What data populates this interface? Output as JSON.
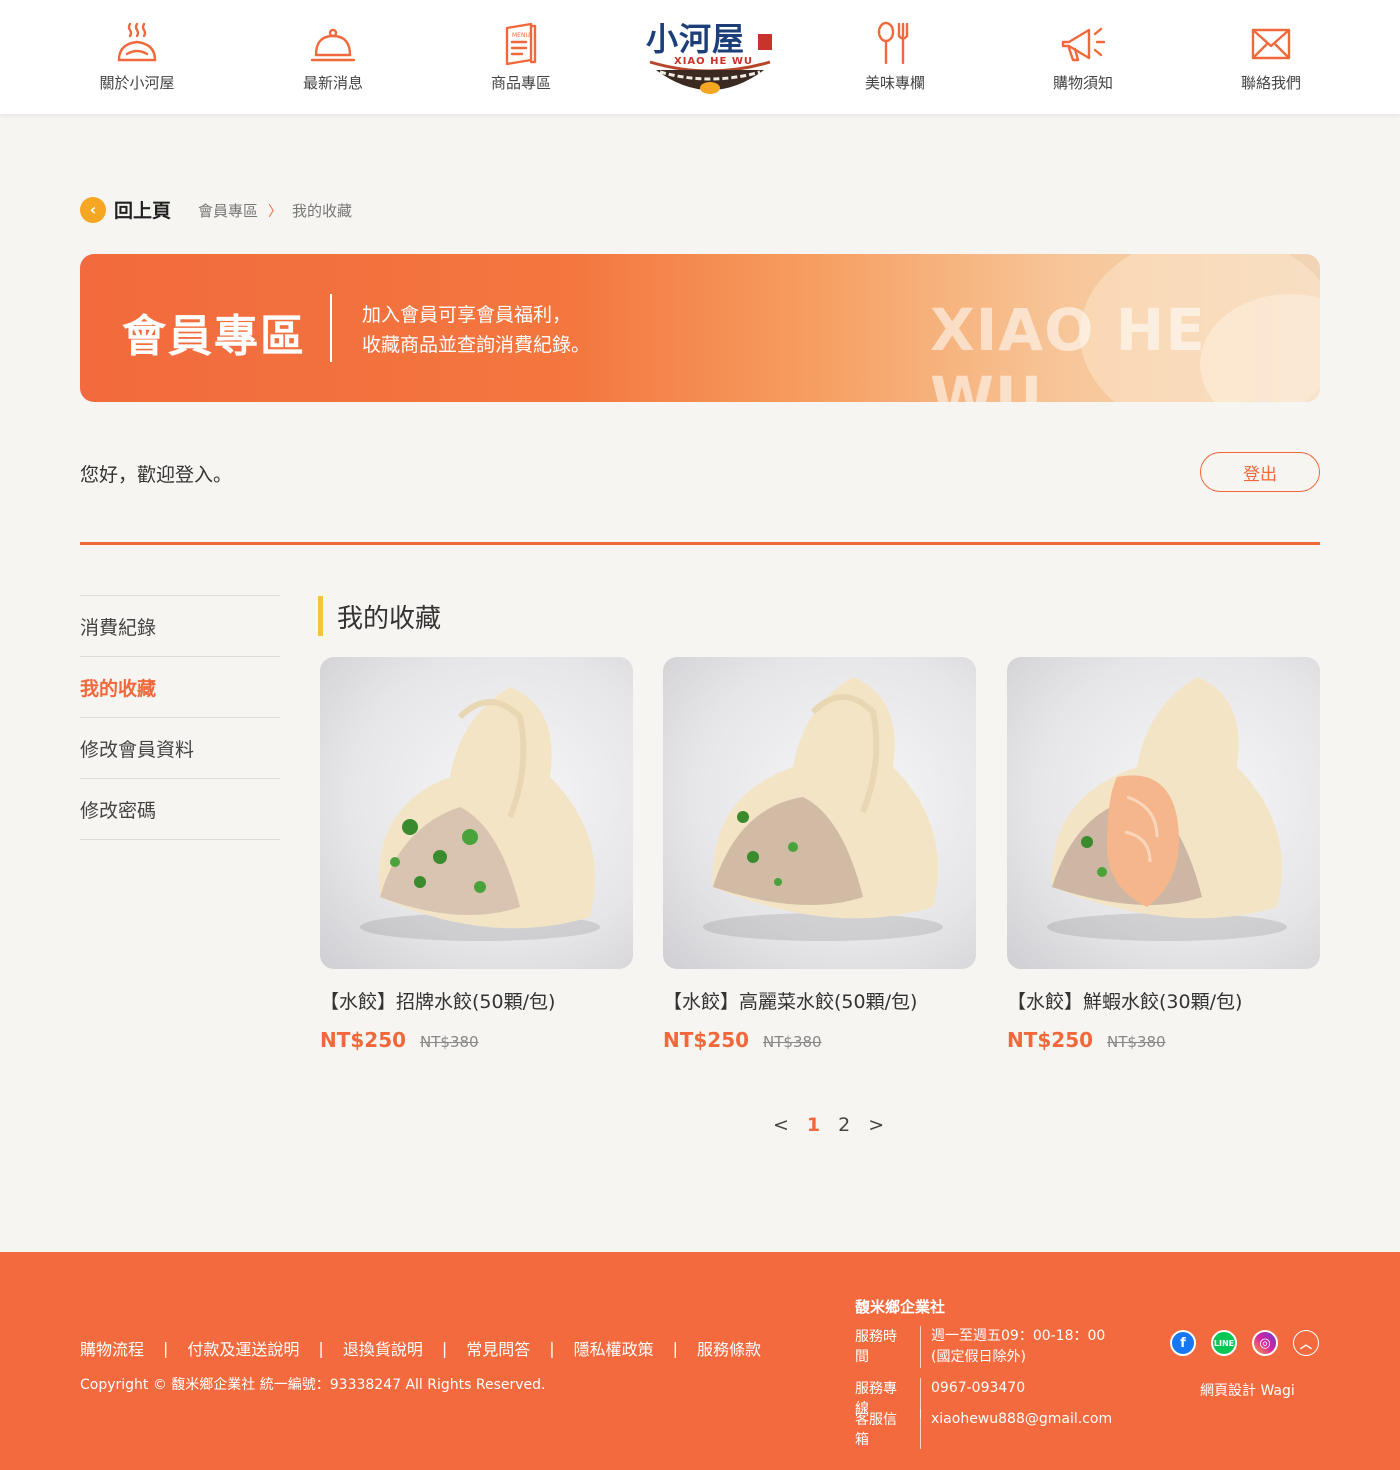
{
  "header": {
    "nav_left": [
      {
        "label": "關於小河屋",
        "icon": "dumpling-steam-icon"
      },
      {
        "label": "最新消息",
        "icon": "cloche-icon"
      },
      {
        "label": "商品專區",
        "icon": "menu-book-icon"
      }
    ],
    "nav_right": [
      {
        "label": "美味專欄",
        "icon": "fork-spoon-icon"
      },
      {
        "label": "購物須知",
        "icon": "megaphone-icon"
      },
      {
        "label": "聯絡我們",
        "icon": "mail-icon"
      }
    ],
    "logo": {
      "title": "小河屋",
      "subtitle": "XIAO HE WU"
    }
  },
  "breadcrumb": {
    "back_label": "回上頁",
    "items": [
      "會員專區",
      "我的收藏"
    ]
  },
  "banner": {
    "title": "會員專區",
    "desc_line1": "加入會員可享會員福利，",
    "desc_line2": "收藏商品並查詢消費紀錄。",
    "watermark": "XIAO HE WU"
  },
  "account": {
    "welcome": "您好，歡迎登入。",
    "logout_label": "登出"
  },
  "side_menu": [
    {
      "label": "消費紀錄",
      "active": false
    },
    {
      "label": "我的收藏",
      "active": true
    },
    {
      "label": "修改會員資料",
      "active": false
    },
    {
      "label": "修改密碼",
      "active": false
    }
  ],
  "favorites": {
    "title": "我的收藏",
    "products": [
      {
        "name": "【水餃】招牌水餃(50顆/包)",
        "price": "NT$250",
        "original_price": "NT$380"
      },
      {
        "name": "【水餃】高麗菜水餃(50顆/包)",
        "price": "NT$250",
        "original_price": "NT$380"
      },
      {
        "name": "【水餃】鮮蝦水餃(30顆/包)",
        "price": "NT$250",
        "original_price": "NT$380"
      }
    ]
  },
  "pagination": {
    "prev": "<",
    "pages": [
      "1",
      "2"
    ],
    "current": "1",
    "next": ">"
  },
  "footer": {
    "links": [
      "購物流程",
      "付款及運送說明",
      "退換貨說明",
      "常見問答",
      "隱私權政策",
      "服務條款"
    ],
    "separator": "|",
    "copyright": "Copyright © 馥米鄉企業社 統一編號：93338247 All Rights Reserved.",
    "company": "馥米鄉企業社",
    "hours_label": "服務時間",
    "hours_line1": "週一至週五09：00-18：00",
    "hours_line2": "(國定假日除外)",
    "phone_label": "服務專線",
    "phone": "0967-093470",
    "email_label": "客服信箱",
    "email": "xiaohewu888@gmail.com",
    "designer": "網頁設計 Wagi",
    "social": [
      "facebook-icon",
      "line-icon",
      "instagram-icon",
      "back-to-top-icon"
    ]
  },
  "colors": {
    "accent": "#f0693c",
    "footer_bg": "#f26a3d",
    "highlight": "#f7c33b",
    "navy": "#1c3f7a"
  }
}
